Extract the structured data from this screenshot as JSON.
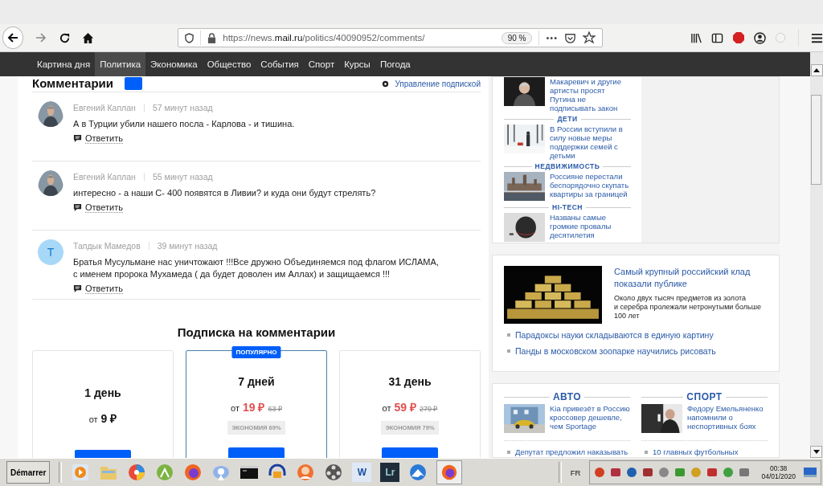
{
  "browser": {
    "url": "https://news.**mail.ru**/politics/40090952/comments/",
    "zoom": "90 %",
    "menu_dots": "•••"
  },
  "nav": [
    {
      "label": "Картина дня",
      "selected": false
    },
    {
      "label": "Политика",
      "selected": true
    },
    {
      "label": "Экономика",
      "selected": false
    },
    {
      "label": "Общество",
      "selected": false
    },
    {
      "label": "События",
      "selected": false
    },
    {
      "label": "Спорт",
      "selected": false
    },
    {
      "label": "Курсы",
      "selected": false
    },
    {
      "label": "Погода",
      "selected": false
    }
  ],
  "comments": {
    "title": "Комментарии",
    "manage_link": "Управление подпиской",
    "items": [
      {
        "author": "Евгений Каплан",
        "time": "57 минут назад",
        "text": "А в Турции убили нашего посла - Карлова - и тишина.",
        "reply": "Ответить"
      },
      {
        "author": "Евгений Каплан",
        "time": "55 минут назад",
        "text": "интересно - а наши С- 400 появятся в Ливии? и куда они будут стрелять?",
        "reply": "Ответить"
      },
      {
        "author": "Тапдык Мамедов",
        "time": "39 минут назад",
        "text": "Братья Мусульмане нас уничтожают !!!Все дружно Объединяемся под флагом ИСЛАМА,\nс именем пророка Мухамеда ( да будет доволен им Аллах) и защищаемся !!!",
        "initial": "Т",
        "reply": "Ответить"
      }
    ]
  },
  "subscription": {
    "title": "Подписка на комментарии",
    "plans": [
      {
        "name": "1 день",
        "prefix": "от",
        "price": "9 ₽",
        "popular": false
      },
      {
        "name": "7 дней",
        "prefix": "от",
        "price": "19 ₽",
        "old_price": "63 ₽",
        "savings": "ЭКОНОМИЯ 69%",
        "popular": true,
        "badge": "ПОПУЛЯРНО"
      },
      {
        "name": "31 день",
        "prefix": "от",
        "price": "59 ₽",
        "old_price": "279 ₽",
        "savings": "ЭКОНОМИЯ 79%",
        "popular": false
      }
    ]
  },
  "sidebar": {
    "news": [
      {
        "title": "Макаревич и другие артисты просят Путина не подписывать закон"
      },
      {
        "category": "ДЕТИ",
        "title": "В России вступили в силу новые меры поддержки семей с детьми"
      },
      {
        "category": "НЕДВИЖИМОСТЬ",
        "title": "Россияне перестали беспорядочно скупать квартиры за границей"
      },
      {
        "category": "HI-TECH",
        "title": "Названы самые громкие провалы десятилетия"
      }
    ],
    "feature": {
      "title": "Самый крупный российский клад показали публике",
      "description": "Около двух тысяч предметов из золота\nи серебра пролежали нетронутыми больше 100 лет",
      "links": [
        "Парадоксы науки складываются в единую картину",
        "Панды в московском зоопарке научились рисовать"
      ]
    },
    "sections": [
      {
        "category": "АВТО",
        "title": "Kia привезёт в Россию кроссовер дешевле, чем Sportage",
        "link": "Депутат предложил наказывать"
      },
      {
        "category": "СПОРТ",
        "title": "Федору Емельяненко напомнили о неспортивных боях",
        "link": "10 главных футбольных"
      }
    ]
  },
  "taskbar": {
    "start": "Démarrer",
    "word_letter": "W",
    "lr_letter": "Lr",
    "lang": "FR",
    "time": "00:38",
    "date": "04/01/2020"
  }
}
